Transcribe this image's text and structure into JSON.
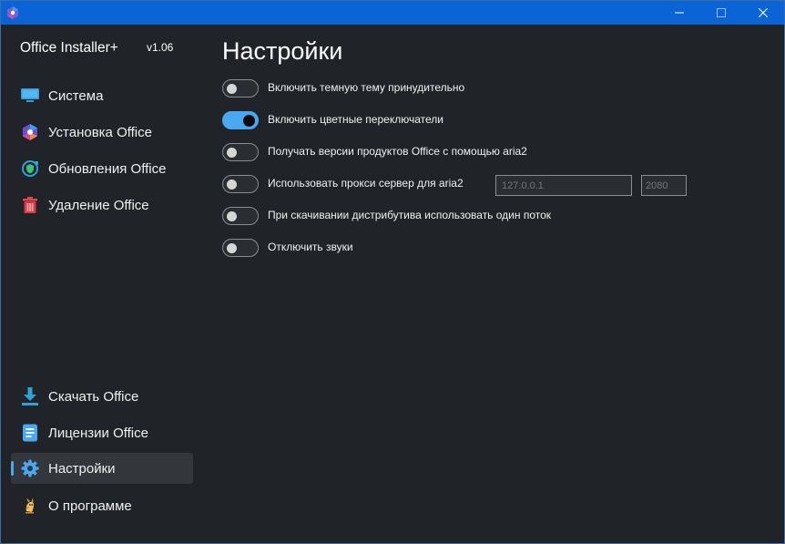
{
  "app": {
    "name": "Office Installer+",
    "version": "v1.06"
  },
  "sidebar": {
    "top_items": [
      {
        "label": "Система",
        "icon": "monitor-icon"
      },
      {
        "label": "Установка Office",
        "icon": "office-logo-icon"
      },
      {
        "label": "Обновления Office",
        "icon": "update-shield-icon"
      },
      {
        "label": "Удаление Office",
        "icon": "trash-icon"
      }
    ],
    "bottom_items": [
      {
        "label": "Скачать Office",
        "icon": "download-icon"
      },
      {
        "label": "Лицензии Office",
        "icon": "license-document-icon"
      },
      {
        "label": "Настройки",
        "icon": "gear-icon",
        "active": true
      },
      {
        "label": "О программе",
        "icon": "about-mascot-icon"
      }
    ]
  },
  "main": {
    "title": "Настройки",
    "settings": [
      {
        "label": "Включить темную тему принудительно",
        "enabled": false
      },
      {
        "label": "Включить цветные переключатели",
        "enabled": true
      },
      {
        "label": "Получать версии продуктов Office с помощью aria2",
        "enabled": false
      },
      {
        "label": "Использовать прокси сервер для aria2",
        "enabled": false
      },
      {
        "label": "При скачивании дистрибутива использовать один поток",
        "enabled": false
      },
      {
        "label": "Отключить звуки",
        "enabled": false
      }
    ],
    "proxy": {
      "host_placeholder": "127.0.0.1",
      "port_placeholder": "2080"
    }
  },
  "colors": {
    "accent": "#4aa8f0",
    "titlebar": "#0a64d6",
    "background": "#202327"
  }
}
